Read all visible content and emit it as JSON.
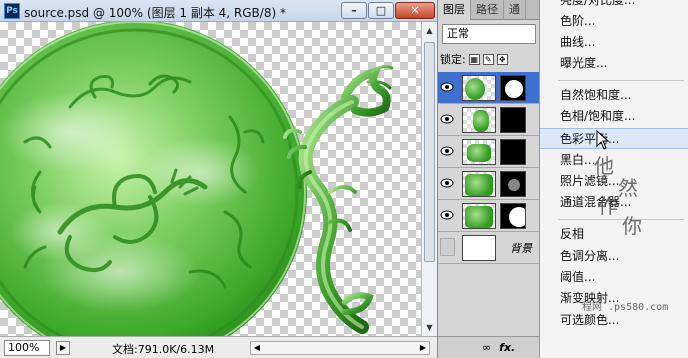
{
  "document": {
    "app_badge": "Ps",
    "title": "source.psd @ 100% (图层 1 副本 4, RGB/8) *",
    "window_buttons": [
      "minimize",
      "restore",
      "close"
    ],
    "zoom": "100%",
    "doc_info": "文档:791.0K/6.13M"
  },
  "layers_panel": {
    "tabs": [
      {
        "label": "图层",
        "active": true
      },
      {
        "label": "路径",
        "active": false
      },
      {
        "label": "通",
        "active": false
      }
    ],
    "blend_mode": "正常",
    "lock_label": "锁定:",
    "layers": [
      {
        "visible": true,
        "selected": true
      },
      {
        "visible": true,
        "selected": false
      },
      {
        "visible": true,
        "selected": false
      },
      {
        "visible": true,
        "selected": false
      },
      {
        "visible": true,
        "selected": false
      },
      {
        "visible": false,
        "selected": false,
        "name": "背景"
      }
    ],
    "bottom_icons": [
      "link-icon",
      "fx-icon"
    ]
  },
  "menu": {
    "items": [
      {
        "label": "亮度/对比度...",
        "highlighted": false
      },
      {
        "label": "色阶...",
        "highlighted": false
      },
      {
        "label": "曲线...",
        "highlighted": false
      },
      {
        "label": "曝光度...",
        "highlighted": false
      },
      {
        "label": "自然饱和度...",
        "highlighted": false
      },
      {
        "label": "色相/饱和度...",
        "highlighted": false
      },
      {
        "label": "色彩平衡...",
        "highlighted": true
      },
      {
        "label": "黑白...",
        "highlighted": false
      },
      {
        "label": "照片滤镜...",
        "highlighted": false
      },
      {
        "label": "通道混合器...",
        "highlighted": false
      },
      {
        "label": "反相",
        "highlighted": false
      },
      {
        "label": "色调分离...",
        "highlighted": false
      },
      {
        "label": "阈值...",
        "highlighted": false
      },
      {
        "label": "渐变映射...",
        "highlighted": false
      },
      {
        "label": "可选颜色...",
        "highlighted": false
      }
    ]
  },
  "watermark": {
    "characters": [
      "他",
      "然",
      "作",
      "你"
    ],
    "url_text": "程网 .ps580.com"
  },
  "colors": {
    "jade_light": "#b8ec9c",
    "jade_mid": "#4fb53a",
    "jade_dark": "#1f7a12",
    "selection": "#3f6fcf",
    "menu_highlight": "#dbe8f7"
  }
}
